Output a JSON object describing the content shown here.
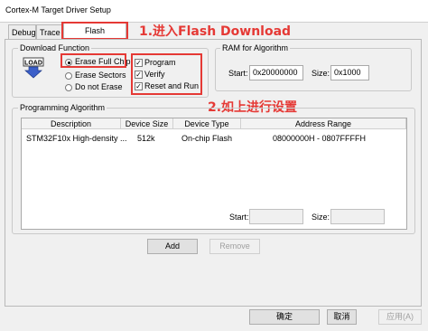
{
  "window": {
    "title": "Cortex-M Target Driver Setup"
  },
  "tabs": [
    {
      "label": "Debug"
    },
    {
      "label": "Trace"
    },
    {
      "label": "Flash Download"
    }
  ],
  "annotations": {
    "step1": "1.进入Flash Download",
    "step2": "2.如上进行设置"
  },
  "download_function": {
    "legend": "Download Function",
    "load_icon_text": "LOAD",
    "radios": [
      {
        "label": "Erase Full Chip",
        "selected": true
      },
      {
        "label": "Erase Sectors",
        "selected": false
      },
      {
        "label": "Do not Erase",
        "selected": false
      }
    ],
    "checks": [
      {
        "label": "Program",
        "checked": true
      },
      {
        "label": "Verify",
        "checked": true
      },
      {
        "label": "Reset and Run",
        "checked": true
      }
    ]
  },
  "ram": {
    "legend": "RAM for Algorithm",
    "start_label": "Start:",
    "start_value": "0x20000000",
    "size_label": "Size:",
    "size_value": "0x1000"
  },
  "programming": {
    "legend": "Programming Algorithm",
    "columns": [
      "Description",
      "Device Size",
      "Device Type",
      "Address Range"
    ],
    "rows": [
      {
        "description": "STM32F10x High-density ...",
        "size": "512k",
        "type": "On-chip Flash",
        "range": "08000000H - 0807FFFFH"
      }
    ],
    "start_label": "Start:",
    "size_label": "Size:",
    "add_label": "Add",
    "remove_label": "Remove"
  },
  "footer": {
    "ok_label": "确定",
    "cancel_label": "取消",
    "apply_label": "应用(A)"
  },
  "colors": {
    "annotation": "#e53935",
    "panel_bg": "#f0f0f0"
  }
}
